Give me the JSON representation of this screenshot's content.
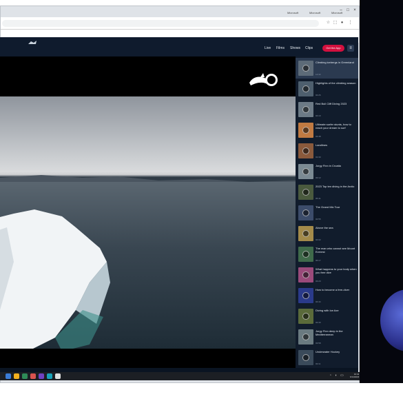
{
  "browser": {
    "tabs": [
      {
        "label": "Microsoft"
      },
      {
        "label": "Microsoft"
      },
      {
        "label": "Microsoft"
      }
    ],
    "url": "",
    "toolbar_icons": [
      "star-icon",
      "extensions-icon",
      "profile-icon",
      "menu-icon"
    ]
  },
  "site": {
    "nav": {
      "logo": "Red Bull",
      "links": [
        "Live",
        "Films",
        "Shows",
        "Clips"
      ],
      "cta": "Get the App",
      "menu_icon": "menu-icon"
    },
    "player": {
      "brand_mark": "Red Bull logo"
    },
    "playlist": [
      {
        "title": "Climbing icebergs in Greenland",
        "duration": "14:32",
        "thumb": "#5d6b78",
        "active": true
      },
      {
        "title": "Highlights of the climbing season",
        "duration": "02:26",
        "thumb": "#4e5f6e"
      },
      {
        "title": "Red Bull Cliff Diving 2023",
        "duration": "04:10",
        "thumb": "#6c7a86"
      },
      {
        "title": "Ultimate surfer stunts, how to reach your dream to surf",
        "duration": "03:48",
        "thumb": "#c07a42"
      },
      {
        "title": "Landlines",
        "duration": "01:30",
        "thumb": "#8a5a3c"
      },
      {
        "title": "Jorgy Finn in Croatia",
        "duration": "03:12",
        "thumb": "#7b8a93"
      },
      {
        "title": "2023 Top ten diving in the Arctic",
        "duration": "05:41",
        "thumb": "#4a5a3e"
      },
      {
        "title": "The Grand Mix Tour",
        "duration": "02:55",
        "thumb": "#3c4c6a"
      },
      {
        "title": "Above the sea",
        "duration": "04:02",
        "thumb": "#a38a4a"
      },
      {
        "title": "The man who cannot see Mount Everest",
        "duration": "06:17",
        "thumb": "#3f6a4a"
      },
      {
        "title": "What happens to your body when you free dive",
        "duration": "03:20",
        "thumb": "#9a4a7a"
      },
      {
        "title": "How to become a free-diver",
        "duration": "04:44",
        "thumb": "#2a3a8a"
      },
      {
        "title": "Diving with Ice Axe",
        "duration": "02:40",
        "thumb": "#5a6a3a"
      },
      {
        "title": "Jorgy Finn deep in the Mediterranean",
        "duration": "03:58",
        "thumb": "#6a7a80"
      },
      {
        "title": "Underwater Hockey",
        "duration": "02:11",
        "thumb": "#3a4a5a"
      }
    ]
  },
  "taskbar": {
    "apps": [
      "#3a7bd5",
      "#f2b01e",
      "#2e8b57",
      "#d9534f",
      "#6f42c1",
      "#17a2b8",
      "#e0e0e0"
    ],
    "time": "10:42",
    "date": "6/14/2023"
  }
}
